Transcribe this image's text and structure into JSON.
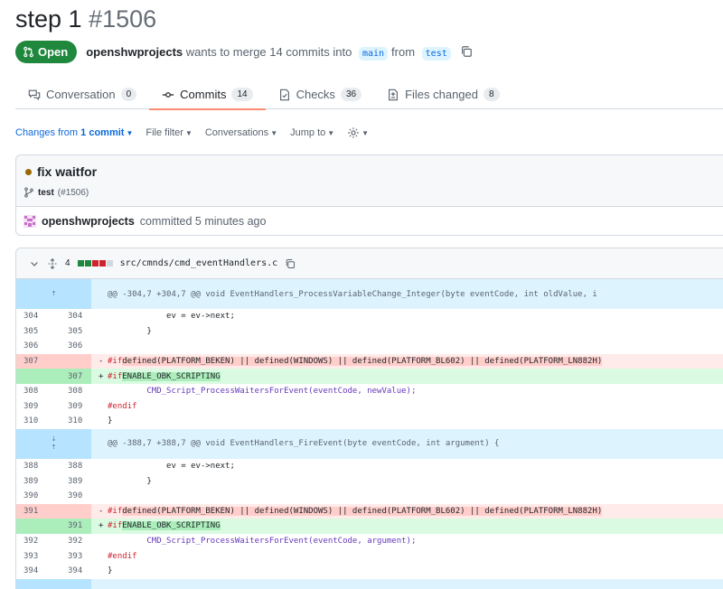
{
  "pr": {
    "title": "step 1",
    "number": "#1506",
    "state": "Open",
    "author": "openshwprojects",
    "merge_text": "wants to merge 14 commits into",
    "base_branch": "main",
    "from_text": "from",
    "head_branch": "test"
  },
  "tabs": [
    {
      "label": "Conversation",
      "count": "0",
      "icon": "comment-discussion-icon"
    },
    {
      "label": "Commits",
      "count": "14",
      "icon": "git-commit-icon"
    },
    {
      "label": "Checks",
      "count": "36",
      "icon": "checklist-icon"
    },
    {
      "label": "Files changed",
      "count": "8",
      "icon": "file-diff-icon"
    }
  ],
  "toolbar": {
    "changes_prefix": "Changes from",
    "changes_value": "1 commit",
    "file_filter": "File filter",
    "conversations": "Conversations",
    "jump_to": "Jump to"
  },
  "commit": {
    "message": "fix waitfor",
    "branch": "test",
    "pr_ref": "(#1506)",
    "author": "openshwprojects",
    "committed_text": "committed 5 minutes ago"
  },
  "file": {
    "changes": "4",
    "name": "src/cmnds/cmd_eventHandlers.c"
  },
  "hunks": [
    {
      "header": "@@ -304,7 +304,7 @@ void EventHandlers_ProcessVariableChange_Integer(byte eventCode, int oldValue, i",
      "lines": [
        {
          "old": "304",
          "new": "304",
          "code": "\t\tev = ev->next;"
        },
        {
          "old": "305",
          "new": "305",
          "code": "\t}"
        },
        {
          "old": "306",
          "new": "306",
          "code": ""
        },
        {
          "old": "307",
          "new": "",
          "type": "del",
          "code": "#if defined(PLATFORM_BEKEN) || defined(WINDOWS) || defined(PLATFORM_BL602) || defined(PLATFORM_LN882H)"
        },
        {
          "old": "",
          "new": "307",
          "type": "add",
          "code": "#if ENABLE_OBK_SCRIPTING"
        },
        {
          "old": "308",
          "new": "308",
          "code": "\tCMD_Script_ProcessWaitersForEvent(eventCode, newValue);"
        },
        {
          "old": "309",
          "new": "309",
          "code": "#endif"
        },
        {
          "old": "310",
          "new": "310",
          "code": "}"
        }
      ]
    },
    {
      "header": "@@ -388,7 +388,7 @@ void EventHandlers_FireEvent(byte eventCode, int argument) {",
      "lines": [
        {
          "old": "388",
          "new": "388",
          "code": "\t\tev = ev->next;"
        },
        {
          "old": "389",
          "new": "389",
          "code": "\t}"
        },
        {
          "old": "390",
          "new": "390",
          "code": ""
        },
        {
          "old": "391",
          "new": "",
          "type": "del",
          "code": "#if defined(PLATFORM_BEKEN) || defined(WINDOWS) || defined(PLATFORM_BL602) || defined(PLATFORM_LN882H)"
        },
        {
          "old": "",
          "new": "391",
          "type": "add",
          "code": "#if ENABLE_OBK_SCRIPTING"
        },
        {
          "old": "392",
          "new": "392",
          "code": "\tCMD_Script_ProcessWaitersForEvent(eventCode, argument);"
        },
        {
          "old": "393",
          "new": "393",
          "code": "#endif"
        },
        {
          "old": "394",
          "new": "394",
          "code": "}"
        }
      ]
    }
  ]
}
